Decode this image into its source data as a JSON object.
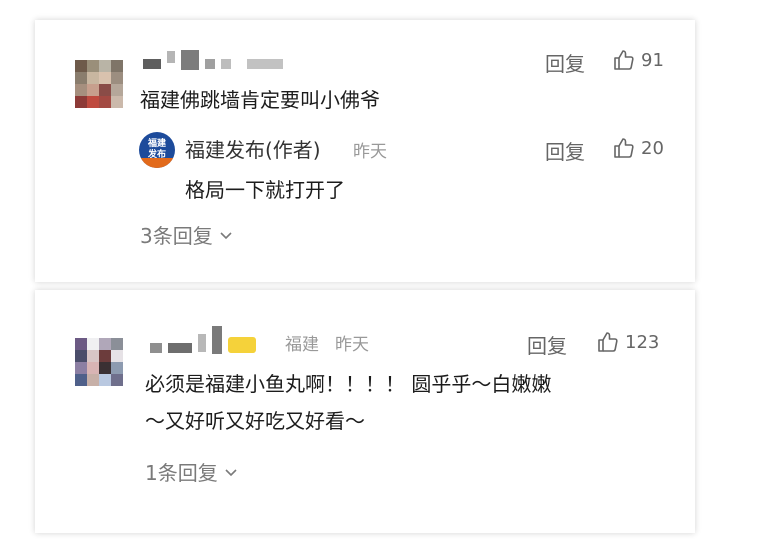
{
  "comments": [
    {
      "text": "福建佛跳墙肯定要叫小佛爷",
      "reply_label": "回复",
      "likes": "91",
      "author_reply": {
        "name": "福建发布(作者)",
        "time": "昨天",
        "text": "格局一下就打开了",
        "reply_label": "回复",
        "likes": "20",
        "avatar_text_top": "福建",
        "avatar_text_bottom": "发布"
      },
      "more_replies": "3条回复"
    },
    {
      "location": "福建",
      "time": "昨天",
      "text_line1": "必须是福建小鱼丸啊！！！！ 圆乎乎～白嫩嫩",
      "text_line2": "～又好听又好吃又好看～",
      "reply_label": "回复",
      "likes": "123",
      "more_replies": "1条回复"
    }
  ]
}
